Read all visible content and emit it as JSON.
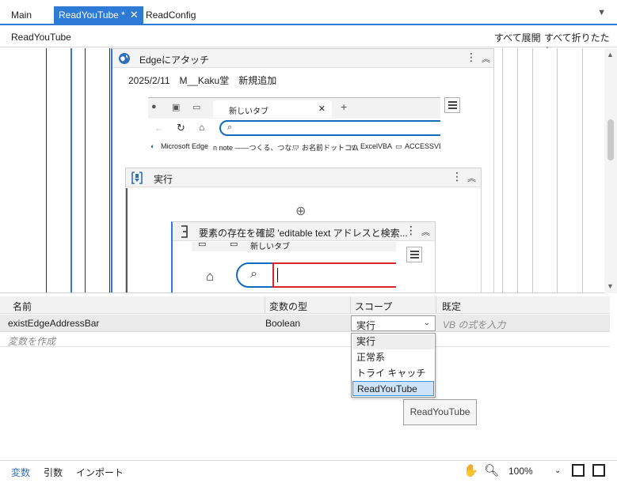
{
  "tabs": [
    {
      "label": "Main"
    },
    {
      "label": "ReadYouTube *"
    },
    {
      "label": "ReadConfig"
    }
  ],
  "breadcrumb": "ReadYouTube",
  "toolbar": {
    "expand_all": "すべて展開",
    "collapse_all": "すべて折りたたむ"
  },
  "attach_card": {
    "title": "Edgeにアタッチ",
    "note": "2025/2/11　M__Kaku堂　新規追加",
    "browser_tab": "新しいタブ",
    "bookmarks": [
      "Microsoft Edge",
      "n  note ――つくる、つな...",
      "お名前ドットコム",
      "ExcelVBA",
      "ACCESSVBA"
    ]
  },
  "run_card": {
    "title": "実行"
  },
  "check_card": {
    "title": "要素の存在を確認 'editable text  アドレスと検索...",
    "browser_tab": "新しいタブ"
  },
  "variables": {
    "headers": {
      "name": "名前",
      "type": "変数の型",
      "scope": "スコープ",
      "default": "既定"
    },
    "rows": [
      {
        "name": "existEdgeAddressBar",
        "type": "Boolean",
        "scope": "実行",
        "default_placeholder": "VB の式を入力"
      }
    ],
    "create_placeholder": "変数を作成"
  },
  "scope_dropdown": {
    "options": [
      "実行",
      "正常系",
      "トライ キャッチ",
      "ReadYouTube"
    ],
    "selected_index": 3,
    "tooltip": "ReadYouTube"
  },
  "bottom": {
    "tabs": [
      "変数",
      "引数",
      "インポート"
    ],
    "zoom": "100%"
  },
  "colors": {
    "accent": "#2e7bd6",
    "selected_option": "#cde3f8",
    "edge_blue": "#0f6cbd",
    "error_red": "#d9232e"
  }
}
